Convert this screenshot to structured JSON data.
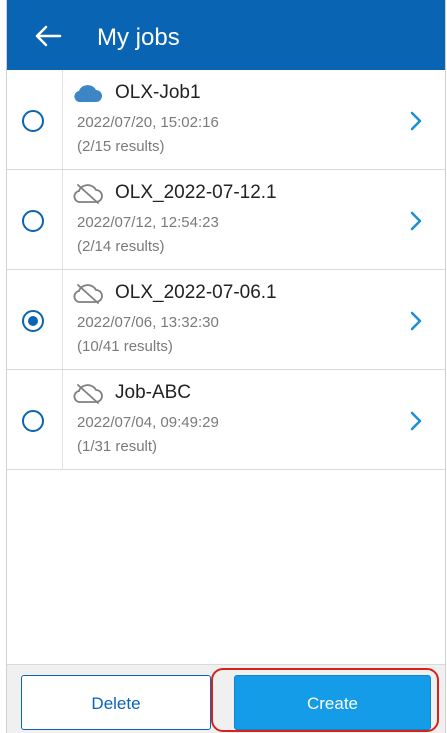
{
  "header": {
    "title": "My jobs",
    "color": "#0a64b4"
  },
  "jobs": [
    {
      "name": "OLX-Job1",
      "date": "2022/07/20, 15:02:16",
      "results": "(2/15 results)",
      "cloud": "synced",
      "selected": false
    },
    {
      "name": "OLX_2022-07-12.1",
      "date": "2022/07/12, 12:54:23",
      "results": "(2/14 results)",
      "cloud": "offline",
      "selected": false
    },
    {
      "name": "OLX_2022-07-06.1",
      "date": "2022/07/06, 13:32:30",
      "results": "(10/41 results)",
      "cloud": "offline",
      "selected": true
    },
    {
      "name": "Job-ABC",
      "date": "2022/07/04, 09:49:29",
      "results": "(1/31 result)",
      "cloud": "offline",
      "selected": false
    }
  ],
  "footer": {
    "delete_label": "Delete",
    "create_label": "Create"
  },
  "icons": {
    "back": "arrow-left-icon",
    "cloud_synced": "cloud-icon",
    "cloud_offline": "cloud-off-icon",
    "chevron": "chevron-right-icon"
  },
  "colors": {
    "accent": "#0a64b4",
    "create_button": "#149ce8",
    "highlight": "#d6221c"
  }
}
